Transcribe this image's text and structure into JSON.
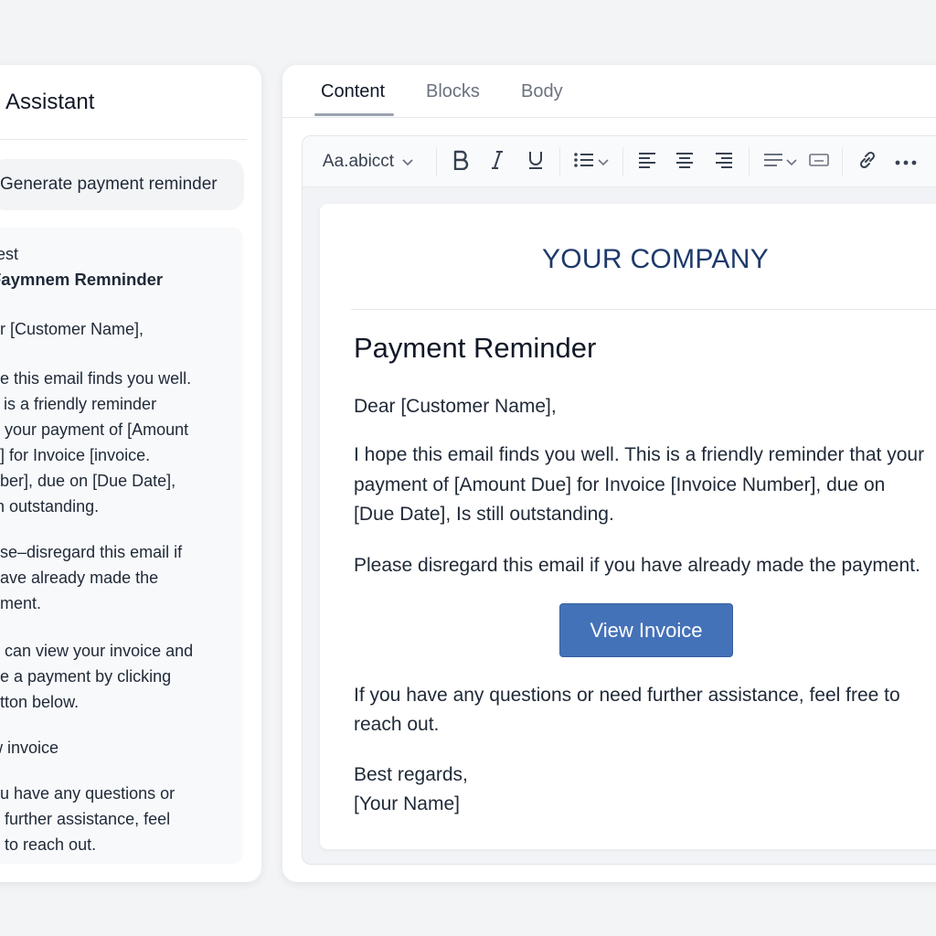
{
  "assistant": {
    "title": "Assistant",
    "prompt": "Generate payment reminder",
    "response_lines": [
      "rest",
      "Faymnem Remninder",
      "ur [Customer Name],",
      "pe this email finds you well.",
      "s is a friendly reminder",
      "n your payment of [Amount",
      "e] for Invoice [invoice.",
      "nber], due on [Due Date],",
      "th outstanding.",
      "ase–disregard this email if",
      "have already made the",
      "ement.",
      "e can view your invoice and",
      "he a payment by clicking",
      "utton below.",
      "w invoice",
      "ou have any questions or",
      "d further assistance, feel",
      "e to reach out."
    ]
  },
  "editor": {
    "tabs": [
      {
        "label": "Content",
        "active": true
      },
      {
        "label": "Blocks",
        "active": false
      },
      {
        "label": "Body",
        "active": false
      }
    ],
    "toolbar": {
      "font_label": "Aa.abicct",
      "icons": [
        "chevron-down-icon",
        "bold-icon",
        "italic-icon",
        "underline-icon",
        "bullet-list-icon",
        "align-left-icon",
        "align-center-icon",
        "align-right-icon",
        "line-spacing-icon",
        "text-box-icon",
        "link-icon",
        "more-icon"
      ]
    },
    "email": {
      "company": "YOUR COMPANY",
      "heading": "Payment Reminder",
      "greeting": "Dear [Customer Name],",
      "body_lines": [
        "I hope this email finds you well. This is a friendly reminder that your",
        "payment of [Amount Due] for Invoice [Invoice Number], due on",
        "[Due Date], Is still outstanding."
      ],
      "disregard": "Please disregard this email if you have already made the payment.",
      "cta_label": "View Invoice",
      "closing_lines": [
        "If you have any questions or need further assistance, feel free to",
        "reach out."
      ],
      "signoff": "Best regards,",
      "signature": "[Your Name]"
    }
  },
  "colors": {
    "company": "#1e3a6b",
    "cta": "#4472b8",
    "background": "#f3f4f6"
  }
}
